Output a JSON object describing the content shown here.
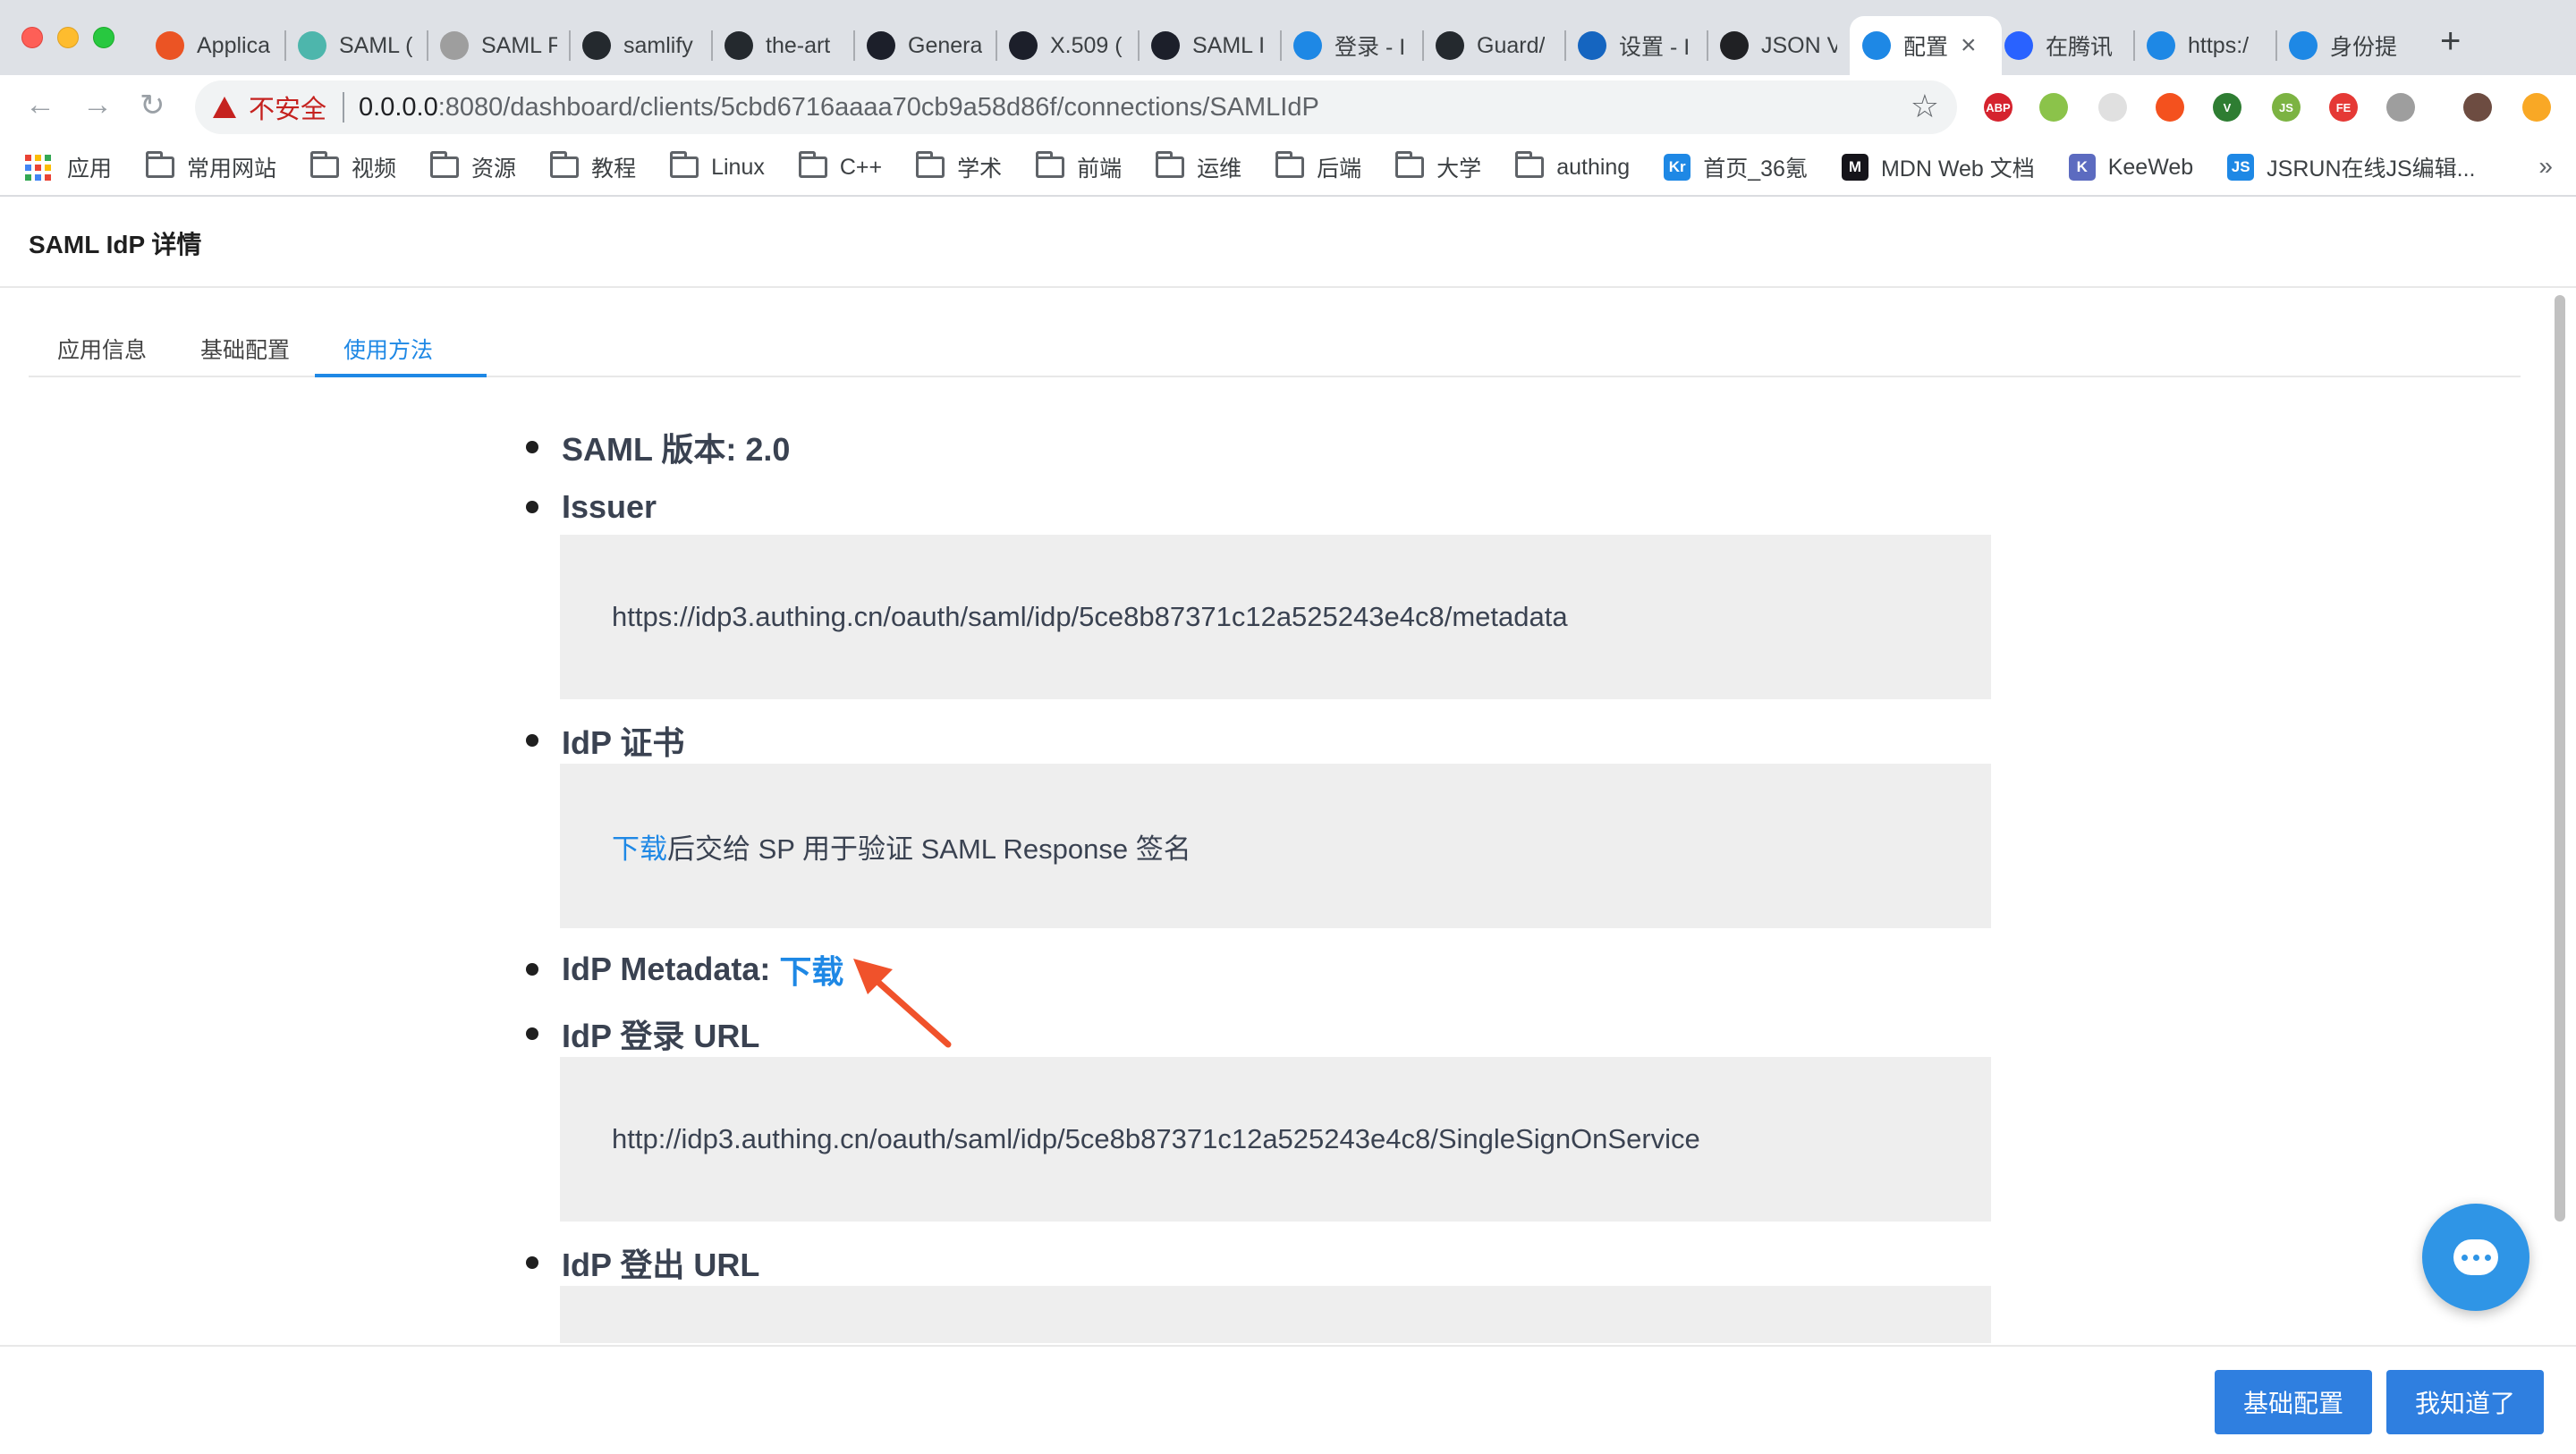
{
  "tabs": [
    {
      "title": "Applica",
      "icon": "auth0-icon",
      "color": "#eb5424"
    },
    {
      "title": "SAML (",
      "icon": "doc-icon",
      "color": "#4db6ac"
    },
    {
      "title": "SAML F",
      "icon": "lock-globe-icon",
      "color": "#9e9e9e"
    },
    {
      "title": "samlify",
      "icon": "github-icon",
      "color": "#24292e"
    },
    {
      "title": "the-art",
      "icon": "github-icon",
      "color": "#24292e"
    },
    {
      "title": "Genera",
      "icon": "onelogin-icon",
      "color": "#1c1f2a"
    },
    {
      "title": "X.509 (",
      "icon": "onelogin-icon",
      "color": "#1c1f2a"
    },
    {
      "title": "SAML I",
      "icon": "onelogin-icon",
      "color": "#1c1f2a"
    },
    {
      "title": "登录 - I",
      "icon": "cloud-icon",
      "color": "#1e88e5"
    },
    {
      "title": "Guard/",
      "icon": "github-icon",
      "color": "#24292e"
    },
    {
      "title": "设置 - I",
      "icon": "gear-icon",
      "color": "#1565c0"
    },
    {
      "title": "JSON V",
      "icon": "json-icon",
      "color": "#202124"
    },
    {
      "title": "配置",
      "icon": "shield-icon",
      "color": "#1e88e5",
      "active": true
    },
    {
      "title": "在腾讯",
      "icon": "stack-icon",
      "color": "#2962ff"
    },
    {
      "title": "https:/",
      "icon": "cloud-icon",
      "color": "#1e88e5"
    },
    {
      "title": "身份提",
      "icon": "cloud-icon",
      "color": "#1e88e5"
    }
  ],
  "toolbar": {
    "insecure_label": "不安全",
    "url_host": "0.0.0.0",
    "url_rest": ":8080/dashboard/clients/5cbd6716aaaa70cb9a58d86f/connections/SAMLIdP"
  },
  "extensions": [
    {
      "name": "adblock-plus-icon",
      "label": "ABP",
      "color": "#d5232e"
    },
    {
      "name": "circle-extension-icon",
      "label": "",
      "color": "#8bc34a"
    },
    {
      "name": "grid-extension-icon",
      "label": "",
      "color": "#e0e0e0"
    },
    {
      "name": "compass-extension-icon",
      "label": "",
      "color": "#f4511e"
    },
    {
      "name": "vue-devtools-icon",
      "label": "V",
      "color": "#2e7d32"
    },
    {
      "name": "nodejs-extension-icon",
      "label": "JS",
      "color": "#7cb342"
    },
    {
      "name": "fe-helper-icon",
      "label": "FE",
      "color": "#e53935"
    },
    {
      "name": "gear-extension-icon",
      "label": "",
      "color": "#9e9e9e"
    },
    {
      "name": "profile-avatar-icon",
      "label": "",
      "color": "#6d4c41"
    },
    {
      "name": "update-icon",
      "label": "",
      "color": "#f9a825"
    }
  ],
  "bookmarks": [
    {
      "label": "应用",
      "type": "apps"
    },
    {
      "label": "常用网站",
      "type": "folder"
    },
    {
      "label": "视频",
      "type": "folder"
    },
    {
      "label": "资源",
      "type": "folder"
    },
    {
      "label": "教程",
      "type": "folder"
    },
    {
      "label": "Linux",
      "type": "folder"
    },
    {
      "label": "C++",
      "type": "folder"
    },
    {
      "label": "学术",
      "type": "folder"
    },
    {
      "label": "前端",
      "type": "folder"
    },
    {
      "label": "运维",
      "type": "folder"
    },
    {
      "label": "后端",
      "type": "folder"
    },
    {
      "label": "大学",
      "type": "folder"
    },
    {
      "label": "authing",
      "type": "folder"
    },
    {
      "label": "首页_36氪",
      "type": "site",
      "glyph": "Kr",
      "color": "#1e88e5"
    },
    {
      "label": "MDN Web 文档",
      "type": "site",
      "glyph": "M",
      "color": "#15141a"
    },
    {
      "label": "KeeWeb",
      "type": "site",
      "glyph": "K",
      "color": "#5c6bc0"
    },
    {
      "label": "JSRUN在线JS编辑...",
      "type": "site",
      "glyph": "JS",
      "color": "#1e88e5"
    }
  ],
  "page": {
    "title": "SAML IdP 详情",
    "tabs": [
      "应用信息",
      "基础配置",
      "使用方法"
    ],
    "active_tab": "使用方法"
  },
  "doc": {
    "saml_version": "SAML 版本: 2.0",
    "issuer_label": "Issuer",
    "issuer_value": "https://idp3.authing.cn/oauth/saml/idp/5ce8b87371c12a525243e4c8/metadata",
    "cert_label": "IdP 证书",
    "cert_link": "下载",
    "cert_text": "后交给 SP 用于验证 SAML Response 签名",
    "metadata_label": "IdP Metadata: ",
    "metadata_link": "下载",
    "login_label": "IdP 登录 URL",
    "login_value": "http://idp3.authing.cn/oauth/saml/idp/5ce8b87371c12a525243e4c8/SingleSignOnService",
    "logout_label": "IdP 登出 URL",
    "logout_value": ""
  },
  "footer": {
    "basic_config_button": "基础配置",
    "got_it_button": "我知道了"
  },
  "colors": {
    "accent": "#1e88e5",
    "annotation_arrow": "#f0522b",
    "button": "#2f7fe0"
  }
}
